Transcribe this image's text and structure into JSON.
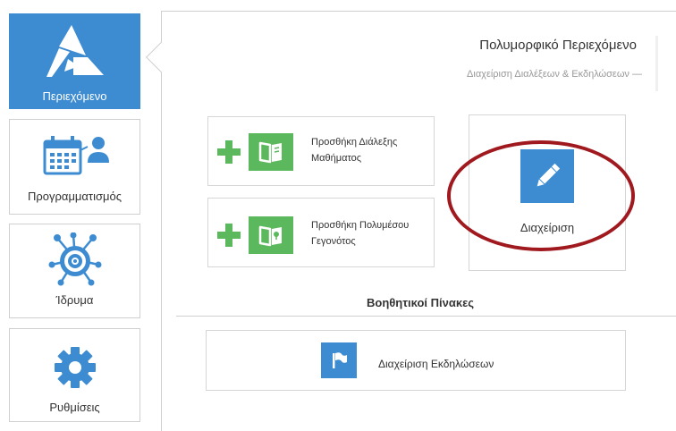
{
  "sidebar": {
    "items": [
      {
        "label": "Περιεχόμενο",
        "icon": "content-logo-icon",
        "active": true
      },
      {
        "label": "Προγραμματισμός",
        "icon": "calendar-user-icon",
        "active": false
      },
      {
        "label": "Ίδρυμα",
        "icon": "institution-network-icon",
        "active": false
      },
      {
        "label": "Ρυθμίσεις",
        "icon": "gear-icon",
        "active": false
      }
    ]
  },
  "header": {
    "title": "Πολυμορφικό Περιεχόμενο",
    "subtitle": "Διαχείριση Διαλέξεων & Εκδηλώσεων —"
  },
  "actions": {
    "add_lecture": {
      "line1": "Προσθήκη Διάλεξης",
      "line2": "Μαθήματος",
      "icon": "book-icon"
    },
    "add_event": {
      "line1": "Προσθήκη Πολυμέσου",
      "line2": "Γεγονότος",
      "icon": "map-book-icon"
    },
    "manage": {
      "label": "Διαχείριση",
      "icon": "pencil-icon"
    }
  },
  "aux": {
    "title": "Βοηθητικοί Πίνακες",
    "events_manage": {
      "label": "Διαχείριση Εκδηλώσεων",
      "icon": "flag-icon"
    }
  },
  "colors": {
    "primary": "#3d8cd2",
    "green": "#5cb85c",
    "highlight": "#a0191f"
  }
}
